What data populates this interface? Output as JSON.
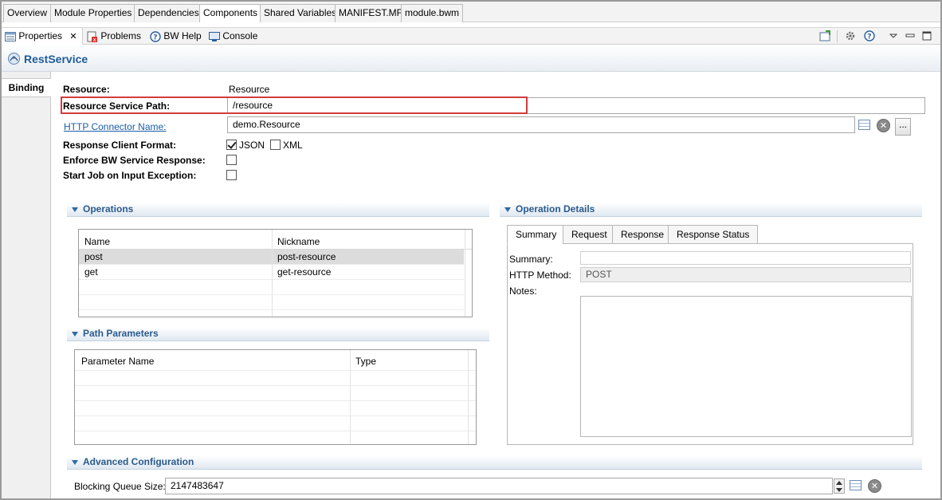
{
  "editor_tabs": [
    "Overview",
    "Module Properties",
    "Dependencies",
    "Components",
    "Shared Variables",
    "MANIFEST.MF",
    "module.bwm"
  ],
  "view_tabs": {
    "properties": "Properties",
    "problems": "Problems",
    "bw_help": "BW Help",
    "console": "Console"
  },
  "header": {
    "title": "RestService"
  },
  "side_tab": "Binding",
  "binding": {
    "resource_label": "Resource:",
    "resource_value": "Resource",
    "service_path_label": "Resource Service Path:",
    "service_path_value": "/resource",
    "connector_label": "HTTP Connector Name:",
    "connector_value": "demo.Resource",
    "browse_label": "...",
    "format_label": "Response Client Format:",
    "json_label": "JSON",
    "xml_label": "XML",
    "json_checked": true,
    "xml_checked": false,
    "enforce_label": "Enforce BW Service Response:",
    "start_job_label": "Start Job on Input Exception:"
  },
  "operations": {
    "title": "Operations",
    "columns": [
      "Name",
      "Nickname"
    ],
    "rows": [
      {
        "name": "post",
        "nickname": "post-resource"
      },
      {
        "name": "get",
        "nickname": "get-resource"
      }
    ]
  },
  "path_parameters": {
    "title": "Path Parameters",
    "columns": [
      "Parameter Name",
      "Type"
    ]
  },
  "operation_details": {
    "title": "Operation Details",
    "tabs": [
      "Summary",
      "Request",
      "Response",
      "Response Status"
    ],
    "summary_label": "Summary:",
    "summary_value": "",
    "method_label": "HTTP Method:",
    "method_value": "POST",
    "notes_label": "Notes:"
  },
  "advanced": {
    "title": "Advanced Configuration",
    "queue_label": "Blocking Queue Size:",
    "queue_value": "2147483647"
  }
}
